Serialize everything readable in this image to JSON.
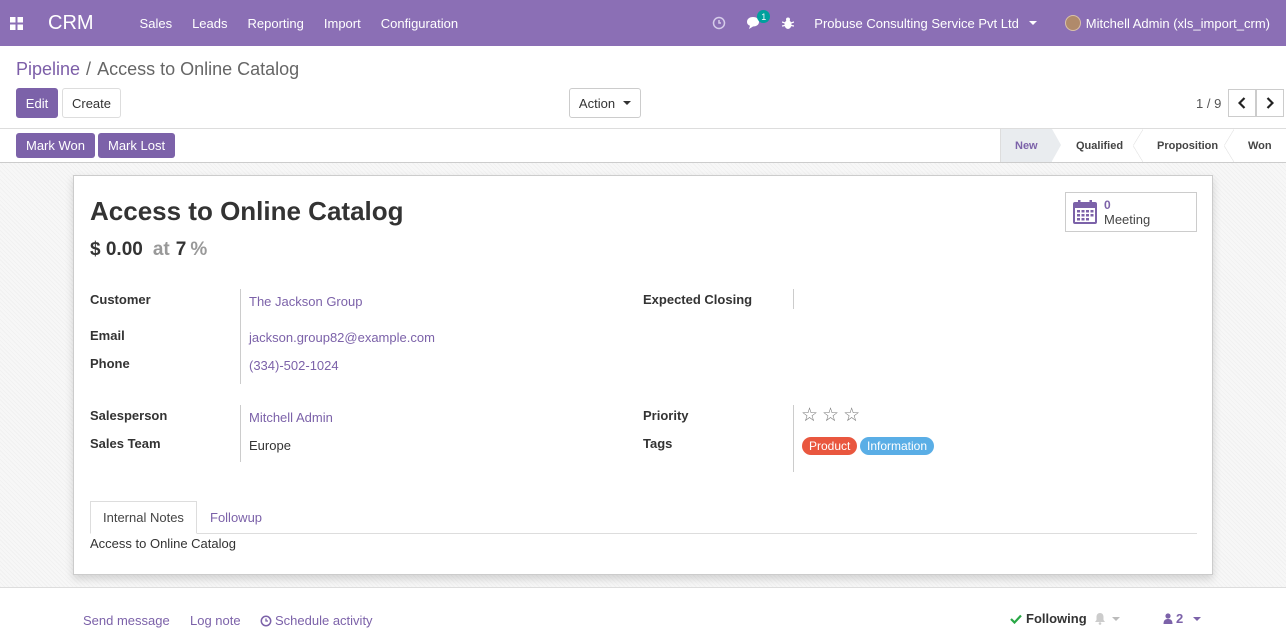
{
  "navbar": {
    "brand": "CRM",
    "menu": [
      "Sales",
      "Leads",
      "Reporting",
      "Import",
      "Configuration"
    ],
    "messages_count": "1",
    "company": "Probuse Consulting Service Pvt Ltd",
    "user": "Mitchell Admin (xls_import_crm)"
  },
  "control_panel": {
    "breadcrumb_parent": "Pipeline",
    "breadcrumb_separator": "/",
    "breadcrumb_current": "Access to Online Catalog",
    "edit_label": "Edit",
    "create_label": "Create",
    "action_label": "Action",
    "pager": "1 / 9"
  },
  "statusbar": {
    "mark_won": "Mark Won",
    "mark_lost": "Mark Lost",
    "stages": [
      "New",
      "Qualified",
      "Proposition",
      "Won"
    ],
    "active_stage": "New"
  },
  "record": {
    "title": "Access to Online Catalog",
    "revenue": "$ 0.00",
    "at": "at",
    "probability": "7",
    "percent": "%",
    "meeting_count": "0",
    "meeting_label": "Meeting",
    "labels": {
      "customer": "Customer",
      "email": "Email",
      "phone": "Phone",
      "expected_closing": "Expected Closing",
      "salesperson": "Salesperson",
      "sales_team": "Sales Team",
      "priority": "Priority",
      "tags": "Tags"
    },
    "customer": "The Jackson Group",
    "email": "jackson.group82@example.com",
    "phone": "(334)-502-1024",
    "expected_closing": "",
    "salesperson": "Mitchell Admin",
    "sales_team": "Europe",
    "priority_stars": 0,
    "priority_max": 3,
    "tags": [
      {
        "label": "Product",
        "color": "#e9573f"
      },
      {
        "label": "Information",
        "color": "#5aaee6"
      }
    ]
  },
  "tabs": {
    "internal_notes": "Internal Notes",
    "followup": "Followup",
    "notes_content": "Access to Online Catalog"
  },
  "chatter": {
    "send_message": "Send message",
    "log_note": "Log note",
    "schedule_activity": "Schedule activity",
    "following": "Following",
    "followers_count": "2"
  },
  "colors": {
    "navbar": "#8b6fb5",
    "primary": "#7c62a9"
  }
}
